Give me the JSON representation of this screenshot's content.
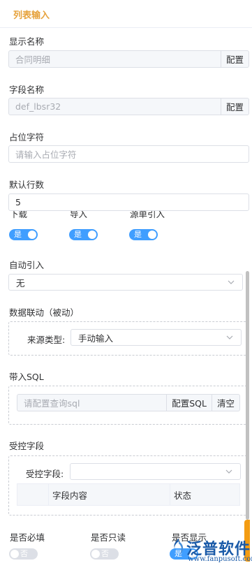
{
  "header": {
    "title": "列表输入"
  },
  "display_name": {
    "label": "显示名称",
    "placeholder": "合同明细",
    "config_btn": "配置"
  },
  "field_name": {
    "label": "字段名称",
    "placeholder": "def_lbsr32",
    "config_btn": "配置"
  },
  "placeholder_text": {
    "label": "占位字符",
    "placeholder": "请输入占位字符"
  },
  "default_rows": {
    "label": "默认行数",
    "value": "5"
  },
  "toggles_row1": [
    {
      "label": "下载",
      "state": "是"
    },
    {
      "label": "导入",
      "state": "是"
    },
    {
      "label": "源单引入",
      "state": "是"
    }
  ],
  "auto_import": {
    "label": "自动引入",
    "selected": "无"
  },
  "data_link": {
    "label": "数据联动（被动）",
    "source_type_label": "来源类型:",
    "source_type_value": "手动输入"
  },
  "bring_sql": {
    "label": "带入SQL",
    "placeholder": "请配置查询sql",
    "config_btn": "配置SQL",
    "clear_btn": "清空"
  },
  "controlled_fields": {
    "label": "受控字段",
    "select_label": "受控字段:",
    "select_value": "",
    "columns": [
      "",
      "字段内容",
      "状态"
    ]
  },
  "toggles_row2": [
    {
      "label": "是否必填",
      "state": "否"
    },
    {
      "label": "是否只读",
      "state": "否"
    },
    {
      "label": "是否显示",
      "state": "是"
    }
  ],
  "watermark": {
    "brand": "泛普软件",
    "url": "www.fanpusoft.com"
  },
  "colors": {
    "accent": "#409eff",
    "header_title": "#e6a23c",
    "brand": "#1a5aa8",
    "scroll_accent": "#f39c12"
  }
}
